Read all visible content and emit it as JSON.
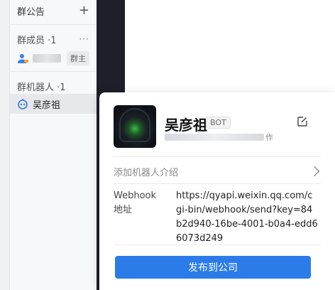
{
  "sidebar": {
    "announcement_label": "群公告",
    "add_symbol": "+",
    "members_label": "群成员 ·1",
    "more_symbol": "···",
    "owner_badge": "群主",
    "robots_label": "群机器人 ·1",
    "robot_name": "吴彦祖"
  },
  "card": {
    "name": "吴彦祖",
    "tag": "BOT",
    "creator_suffix": "作",
    "intro_label": "添加机器人介绍",
    "webhook_label": "Webhook\n地址",
    "webhook_url": "https://qyapi.weixin.qq.com/cgi-bin/webhook/send?key=84b2d940-16be-4001-b0a4-edd66073d249",
    "publish_label": "发布到公司"
  },
  "colors": {
    "accent": "#2b7be9",
    "dark_panel": "#1e1f2b"
  }
}
